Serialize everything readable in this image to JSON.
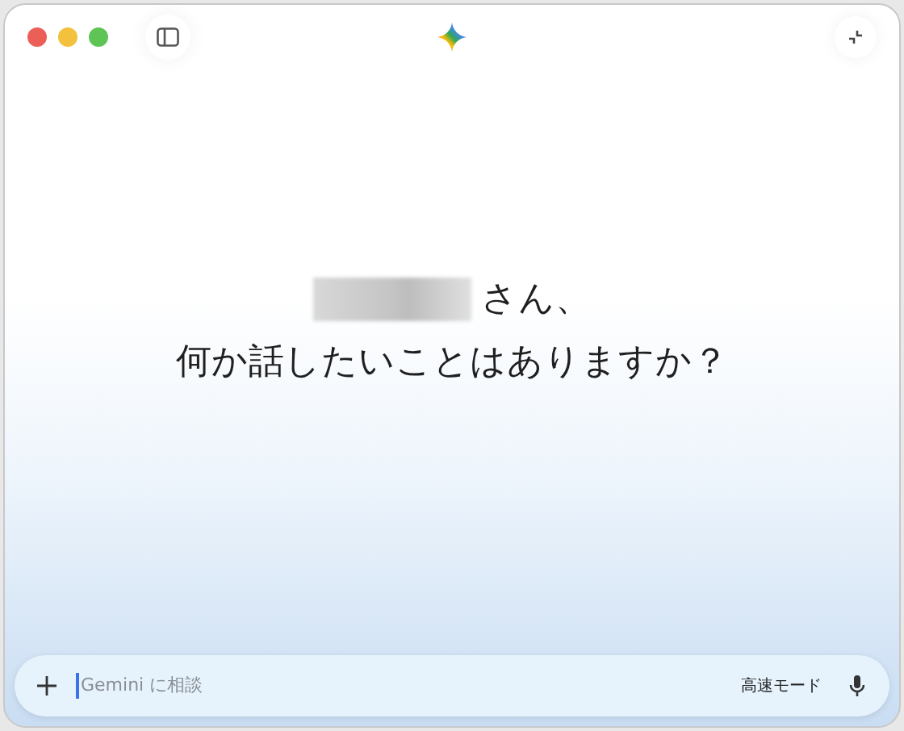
{
  "greeting": {
    "name_suffix": "さん、",
    "question": "何か話したいことはありますか？"
  },
  "composer": {
    "placeholder": "Gemini に相談",
    "mode": "高速モード"
  }
}
